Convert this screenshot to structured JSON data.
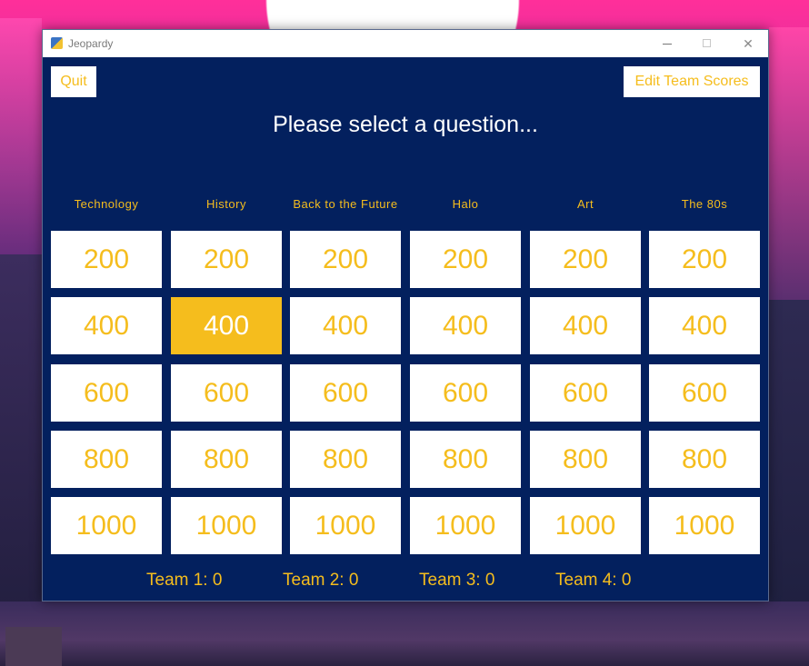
{
  "window": {
    "title": "Jeopardy"
  },
  "toolbar": {
    "quit_label": "Quit",
    "edit_scores_label": "Edit Team Scores"
  },
  "prompt": "Please select a question...",
  "categories": [
    "Technology",
    "History",
    "Back to the Future",
    "Halo",
    "Art",
    "The 80s"
  ],
  "values": [
    "200",
    "400",
    "600",
    "800",
    "1000"
  ],
  "selected_cell": {
    "category": "History",
    "value": "400"
  },
  "teams": [
    {
      "label": "Team 1: 0"
    },
    {
      "label": "Team 2: 0"
    },
    {
      "label": "Team 3: 0"
    },
    {
      "label": "Team 4: 0"
    }
  ],
  "colors": {
    "board": "#03205e",
    "accent": "#f5bd1d",
    "tile": "#ffffff",
    "text": "#ffffff"
  }
}
